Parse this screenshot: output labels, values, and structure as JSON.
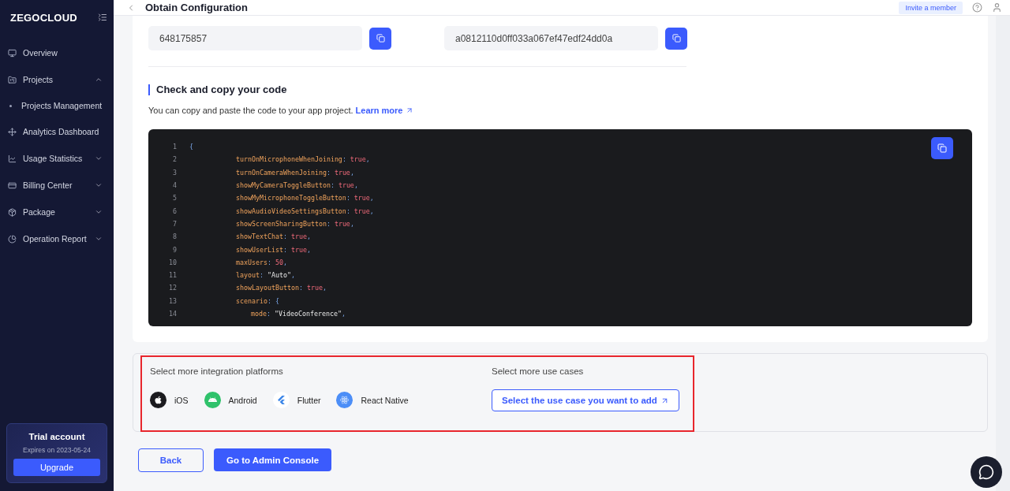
{
  "sidebar": {
    "logo": "ZEGOCLOUD",
    "items": [
      {
        "label": "Overview"
      },
      {
        "label": "Projects",
        "expanded": true,
        "children": [
          {
            "label": "Projects Management"
          }
        ]
      },
      {
        "label": "Analytics Dashboard"
      },
      {
        "label": "Usage Statistics",
        "expanded": false
      },
      {
        "label": "Billing Center",
        "expanded": false
      },
      {
        "label": "Package",
        "expanded": false
      },
      {
        "label": "Operation Report",
        "expanded": false
      }
    ],
    "trial": {
      "title": "Trial account",
      "expires": "Expires on 2023-05-24",
      "button": "Upgrade"
    }
  },
  "header": {
    "title": "Obtain Configuration",
    "invite_button": "Invite a member"
  },
  "credentials": [
    {
      "value": "648175857"
    },
    {
      "value": "a0812110d0ff033a067ef47edf24dd0a"
    }
  ],
  "code_section": {
    "heading": "Check and copy your code",
    "description": "You can copy and paste the code to your app project.",
    "link": "Learn more",
    "lines": [
      {
        "number": "1",
        "tokens": [
          {
            "kind": "punct",
            "text": "{"
          }
        ],
        "children": [
          {
            "number": "2",
            "tokens": [
              {
                "kind": "key",
                "text": "turnOnMicrophoneWhenJoining"
              },
              {
                "kind": "punct",
                "text": ":"
              },
              {
                "kind": "literal",
                "text": " true"
              },
              {
                "kind": "punct",
                "text": ","
              }
            ]
          },
          {
            "number": "3",
            "tokens": [
              {
                "kind": "key",
                "text": "turnOnCameraWhenJoining"
              },
              {
                "kind": "punct",
                "text": ":"
              },
              {
                "kind": "literal",
                "text": " true"
              },
              {
                "kind": "punct",
                "text": ","
              }
            ]
          },
          {
            "number": "4",
            "tokens": [
              {
                "kind": "key",
                "text": "showMyCameraToggleButton"
              },
              {
                "kind": "punct",
                "text": ":"
              },
              {
                "kind": "literal",
                "text": " true"
              },
              {
                "kind": "punct",
                "text": ","
              }
            ]
          },
          {
            "number": "5",
            "tokens": [
              {
                "kind": "key",
                "text": "showMyMicrophoneToggleButton"
              },
              {
                "kind": "punct",
                "text": ":"
              },
              {
                "kind": "literal",
                "text": " true"
              },
              {
                "kind": "punct",
                "text": ","
              }
            ]
          },
          {
            "number": "6",
            "tokens": [
              {
                "kind": "key",
                "text": "showAudioVideoSettingsButton"
              },
              {
                "kind": "punct",
                "text": ":"
              },
              {
                "kind": "literal",
                "text": " true"
              },
              {
                "kind": "punct",
                "text": ","
              }
            ]
          },
          {
            "number": "7",
            "tokens": [
              {
                "kind": "key",
                "text": "showScreenSharingButton"
              },
              {
                "kind": "punct",
                "text": ":"
              },
              {
                "kind": "literal",
                "text": " true"
              },
              {
                "kind": "punct",
                "text": ","
              }
            ]
          },
          {
            "number": "8",
            "tokens": [
              {
                "kind": "key",
                "text": "showTextChat"
              },
              {
                "kind": "punct",
                "text": ":"
              },
              {
                "kind": "literal",
                "text": " true"
              },
              {
                "kind": "punct",
                "text": ","
              }
            ]
          },
          {
            "number": "9",
            "tokens": [
              {
                "kind": "key",
                "text": "showUserList"
              },
              {
                "kind": "punct",
                "text": ":"
              },
              {
                "kind": "literal",
                "text": " true"
              },
              {
                "kind": "punct",
                "text": ","
              }
            ]
          },
          {
            "number": "10",
            "tokens": [
              {
                "kind": "key",
                "text": "maxUsers"
              },
              {
                "kind": "punct",
                "text": ":"
              },
              {
                "kind": "literal",
                "text": " 50"
              },
              {
                "kind": "punct",
                "text": ","
              }
            ]
          },
          {
            "number": "11",
            "tokens": [
              {
                "kind": "key",
                "text": "layout"
              },
              {
                "kind": "punct",
                "text": ":"
              },
              {
                "kind": "string",
                "text": " \"Auto\""
              },
              {
                "kind": "punct",
                "text": ","
              }
            ]
          },
          {
            "number": "12",
            "tokens": [
              {
                "kind": "key",
                "text": "showLayoutButton"
              },
              {
                "kind": "punct",
                "text": ":"
              },
              {
                "kind": "literal",
                "text": " true"
              },
              {
                "kind": "punct",
                "text": ","
              }
            ]
          },
          {
            "number": "13",
            "tokens": [
              {
                "kind": "key",
                "text": "scenario"
              },
              {
                "kind": "punct",
                "text": ":"
              },
              {
                "kind": "punct",
                "text": " {"
              }
            ],
            "children": [
              {
                "number": "14",
                "tokens": [
                  {
                    "kind": "key",
                    "text": "mode"
                  },
                  {
                    "kind": "punct",
                    "text": ":"
                  },
                  {
                    "kind": "string",
                    "text": " \"VideoConference\""
                  },
                  {
                    "kind": "punct",
                    "text": ","
                  }
                ]
              }
            ]
          }
        ]
      }
    ]
  },
  "more": {
    "platforms_title": "Select more integration platforms",
    "platforms": [
      {
        "label": "iOS"
      },
      {
        "label": "Android"
      },
      {
        "label": "Flutter"
      },
      {
        "label": "React Native"
      }
    ],
    "use_cases_title": "Select more use cases",
    "use_case_button": "Select the use case you want to add"
  },
  "actions": {
    "back": "Back",
    "admin": "Go to Admin Console"
  }
}
